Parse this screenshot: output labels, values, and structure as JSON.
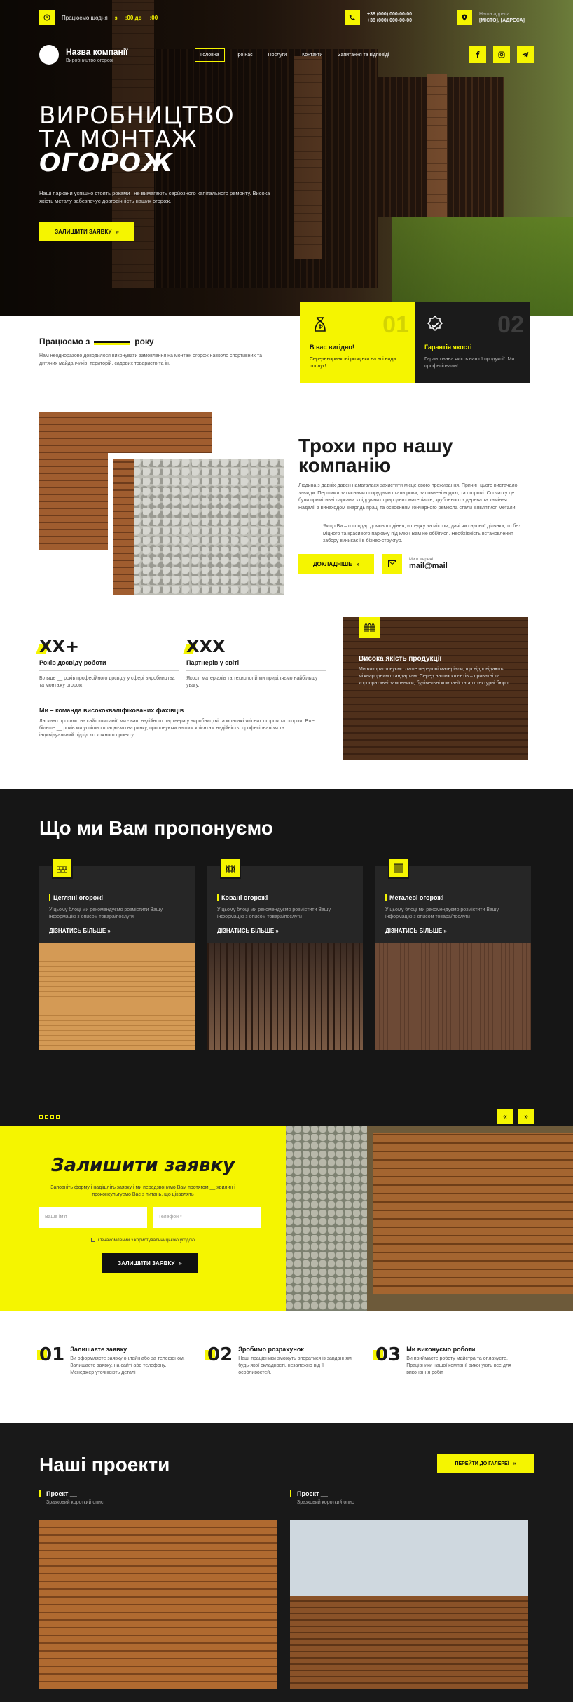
{
  "colors": {
    "accent": "#f5f500",
    "dark": "#161616",
    "text": "#1a1a1a"
  },
  "topbar": {
    "hours_label": "Працюємо щодня",
    "hours_value": "з __:00 до __:00",
    "phone1": "+38 (000) 000-00-00",
    "phone2": "+38 (000) 000-00-00",
    "address_label": "Наша адреса",
    "address_value": "[МІСТО], [АДРЕСА]"
  },
  "nav": {
    "brand_name": "Назва компанії",
    "brand_sub": "Виробництво огорож",
    "items": [
      "Головна",
      "Про нас",
      "Послуги",
      "Контакти",
      "Запитання та відповіді"
    ]
  },
  "hero": {
    "line1": "ВИРОБНИЦТВО",
    "line2": "ТА МОНТАЖ",
    "line3": "ОГОРОЖ",
    "desc": "Наші паркани успішно стоять роками і не вимагають серйозного капітального ремонту. Висока якість металу забезпечує довговічність наших огорож.",
    "cta": "ЗАЛИШИТИ ЗАЯВКУ"
  },
  "work": {
    "title_a": "Працюємо з",
    "title_b": "року",
    "text": "Нам неодноразово доводилося виконувати замовлення на монтаж огорож навколо спортивних та дитячих майданчиків, територій, садових товариств та ін.",
    "cards": [
      {
        "num": "01",
        "title": "В нас вигідно!",
        "desc": "Середньоринкові розцінки на всі види послуг!"
      },
      {
        "num": "02",
        "title": "Гарантія якості",
        "desc": "Гарантована якість нашої продукції. Ми професіонали!"
      }
    ]
  },
  "about": {
    "title": "Трохи про нашу компанію",
    "p1": "Людина з давніх-давен намагалася захистити місце свого проживання. Причин цього вистачало завжди. Першими захисними спорудами стали рови, заповнені водою, та огорожі. Спочатку це були примітивні паркани з підручних природних матеріалів, зрубленого з дерева та каміння. Надалі, з винаходом знарядь праці та освоєнням гончарного ремесла стали з'являтися метали.",
    "quote": "Якщо Ви – господар домоволодіння, котеджу за містом, дачі чи садової ділянки, то без міцного та красивого паркану під ключ Вам не обійтися. Необхідність встановлення забору виникає і в бізнес-структур.",
    "cta": "ДОКЛАДНІШЕ",
    "mail_label": "Ми в мережі",
    "mail_value": "mail@mail"
  },
  "stats": {
    "items": [
      {
        "num": "XX+",
        "label": "Років досвіду роботи",
        "desc": "Більше __ років професійного досвіду у сфері виробництва та монтажу огорож."
      },
      {
        "num": "XXX",
        "label": "Партнерів у світі",
        "desc": "Якості матеріалів та технологій ми приділяємо найбільшу увагу."
      }
    ],
    "team_title": "Ми – команда висококваліфікованих фахівців",
    "team_text": "Ласкаво просимо на сайт компанії, ми - ваш надійного партнера у виробництві та монтажі якісних огорож та огорож. Вже більше __ років ми успішно працюємо на ринку, пропонуючи нашим клієнтам надійність, професіоналізм та індивідуальний підхід до кожного проекту.",
    "quality_title": "Висока якість продукції",
    "quality_text": "Ми використовуємо лише передові матеріали, що відповідають міжнародним стандартам. Серед наших клієнтів – приватні та корпоративні замовники, будівельні компанії та архітектурні бюро."
  },
  "offer": {
    "title": "Що ми Вам пропонуємо",
    "items": [
      {
        "title": "Цегляні огорожі",
        "desc": "У цьому блоці ми рекомендуємо розмістити Вашу інформацію з описом товара/послуги",
        "more": "ДІЗНАТИСЬ БІЛЬШЕ"
      },
      {
        "title": "Ковані огорожі",
        "desc": "У цьому блоці ми рекомендуємо розмістити Вашу інформацію з описом товара/послуги",
        "more": "ДІЗНАТИСЬ БІЛЬШЕ"
      },
      {
        "title": "Металеві огорожі",
        "desc": "У цьому блоці ми рекомендуємо розмістити Вашу інформацію з описом товара/послуги",
        "more": "ДІЗНАТИСЬ БІЛЬШЕ"
      }
    ]
  },
  "form": {
    "title": "Залишити заявку",
    "sub": "Заповніть форму і надішліть заявку і ми передзвонимо Вам протягом __ хвилин і проконсультуємо Вас з питань, що цікавлять",
    "name_ph": "Ваше ім'я",
    "phone_ph": "Телефон *",
    "agree": "Ознайомлений з користувальницькою угодою",
    "submit": "ЗАЛИШИТИ ЗАЯВКУ"
  },
  "steps": [
    {
      "num": "01",
      "title": "Залишаєте заявку",
      "desc": "Ви оформляєте заявку онлайн або за телефоном. Залишаєте заявку, на сайті або телефону. Менеджер уточнюють деталі"
    },
    {
      "num": "02",
      "title": "Зробимо розрахунок",
      "desc": "Наші працівники зможуть впоратися із завданням будь-якої складності, незалежно від її особливостей."
    },
    {
      "num": "03",
      "title": "Ми виконуємо роботи",
      "desc": "Ви приймаєте роботу майстра та оплачуєте. Працівники нашої компанії виконують все для виконання робіт"
    }
  ],
  "projects": {
    "title": "Наші проекти",
    "gallery": "ПЕРЕЙТИ ДО ГАЛЕРЕЇ",
    "items": [
      {
        "title": "Проект __",
        "desc": "Зразковий короткий опис"
      },
      {
        "title": "Проект __",
        "desc": "Зразковий короткий опис"
      }
    ]
  }
}
